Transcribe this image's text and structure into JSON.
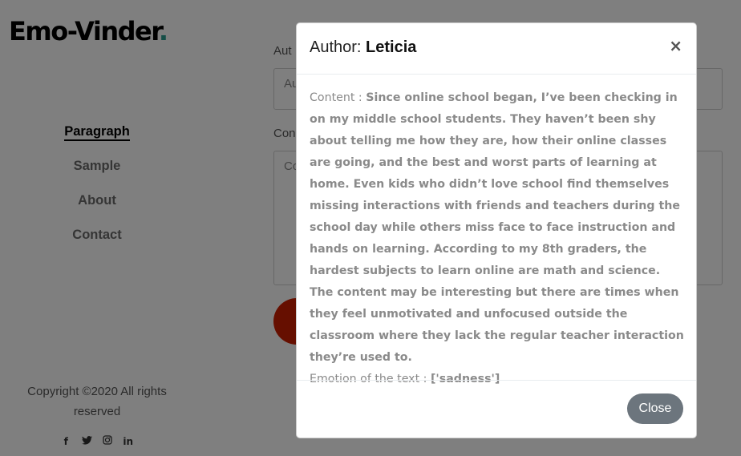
{
  "sidebar": {
    "logo_text": "Emo-Vinder",
    "logo_dot": ".",
    "nav": [
      {
        "label": "Paragraph"
      },
      {
        "label": "Sample"
      },
      {
        "label": "About"
      },
      {
        "label": "Contact"
      }
    ],
    "copyright_line1": "Copyright ©2020 All rights",
    "copyright_line2": "reserved",
    "social_icons": [
      "facebook-icon",
      "twitter-icon",
      "instagram-icon",
      "linkedin-icon"
    ],
    "social_glyphs": [
      "f",
      "🐦",
      "◎",
      "in"
    ]
  },
  "form": {
    "author_label": "Aut",
    "author_placeholder": "Au",
    "content_label": "Con",
    "content_placeholder": "Co"
  },
  "modal": {
    "title_prefix": "Author:",
    "author_name": "Leticia",
    "close_x": "×",
    "content_label": "Content :",
    "content_text": "Since online school began, I’ve been checking in on my middle school students. They haven’t been shy about telling me how they are, how their online classes are going, and the best and worst parts of learning at home. Even kids who didn’t love school find themselves missing interactions with friends and teachers during the school day while others miss face to face instruction and hands on learning. According to my 8th graders, the hardest subjects to learn online are math and science. The content may be interesting but there are times when they feel unmotivated and unfocused outside the classroom where they lack the regular teacher interaction they’re used to.",
    "emotion_label": "Emotion of the text :",
    "emotion_value": "['sadness']",
    "close_button": "Close"
  },
  "colors": {
    "accent_dot": "#2a9d8f",
    "submit": "#cc1f00",
    "close_button_bg": "#6c757d"
  }
}
